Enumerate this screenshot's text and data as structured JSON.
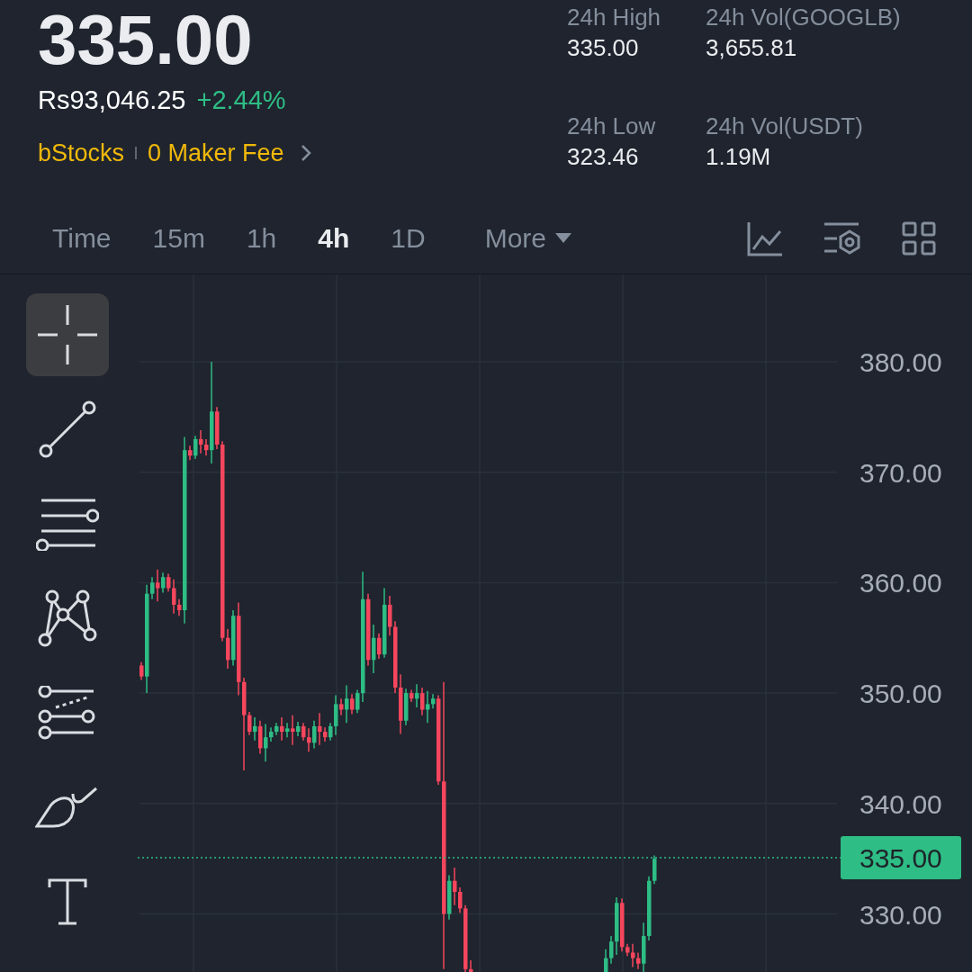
{
  "ticker": {
    "price": "335.00",
    "fiat_price": "Rs93,046.25",
    "change": "+2.44%",
    "tags": [
      "bStocks",
      "0 Maker Fee"
    ]
  },
  "stats": [
    {
      "label": "24h High",
      "value": "335.00"
    },
    {
      "label": "24h Vol(GOOGLB)",
      "value": "3,655.81"
    },
    {
      "label": "24h Low",
      "value": "323.46"
    },
    {
      "label": "24h Vol(USDT)",
      "value": "1.19M"
    }
  ],
  "intervals": [
    {
      "label": "Time",
      "selected": false,
      "kind": "option"
    },
    {
      "label": "15m",
      "selected": false,
      "kind": "option"
    },
    {
      "label": "1h",
      "selected": false,
      "kind": "option"
    },
    {
      "label": "4h",
      "selected": true,
      "kind": "option"
    },
    {
      "label": "1D",
      "selected": false,
      "kind": "option"
    },
    {
      "label": "More",
      "selected": false,
      "kind": "dropdown"
    }
  ],
  "drawing_tools": [
    {
      "selected": true
    },
    {
      "selected": false
    },
    {
      "selected": false
    },
    {
      "selected": false
    },
    {
      "selected": false
    },
    {
      "selected": false
    },
    {
      "selected": false
    }
  ],
  "price_axis": {
    "labels": [
      "380.00",
      "370.00",
      "360.00",
      "350.00",
      "340.00",
      "330.00"
    ],
    "current_price": "335.00"
  }
}
